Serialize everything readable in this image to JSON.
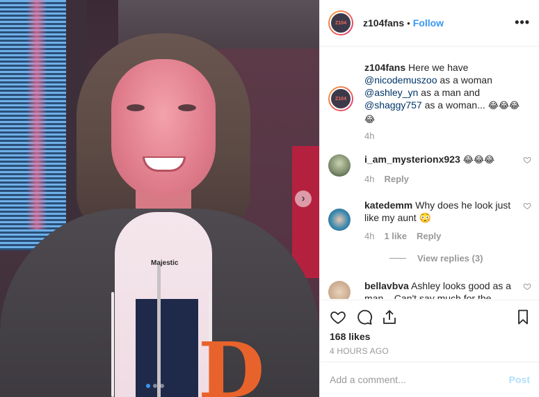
{
  "post": {
    "username": "z104fans",
    "follow_label": "Follow",
    "separator": "•",
    "more_label": "•••",
    "avatar_text": "Z104"
  },
  "photo": {
    "brand_mark": "Majestic",
    "team_logo": "D",
    "next_arrow": "›",
    "carousel_count": 3,
    "carousel_active": 0
  },
  "caption": {
    "username": "z104fans",
    "text_1": "Here we have",
    "mention_1": "@nicodemuszoo",
    "text_2": "as a woman",
    "mention_2": "@ashley_yn",
    "text_3": "as a man and",
    "mention_3": "@shaggy757",
    "text_4": "as a woman...",
    "emojis": "😂😂😂 😂",
    "time": "4h"
  },
  "comments": [
    {
      "username": "i_am_mysterionx923",
      "text": "😂😂😂",
      "time": "4h",
      "likes": "",
      "reply_label": "Reply",
      "avatar_color": "#7b8a6a"
    },
    {
      "username": "katedemm",
      "text": "Why does he look just like my aunt 😳",
      "time": "4h",
      "likes": "1 like",
      "reply_label": "Reply",
      "avatar_color": "#3e8ab0",
      "view_replies": "View replies (3)"
    },
    {
      "username": "bellavbva",
      "text": "Ashley looks good as a man... Can't say much for the",
      "time": "",
      "avatar_color": "#c9a98a"
    }
  ],
  "actions": {
    "likes": "168 likes",
    "time_ago": "4 HOURS AGO",
    "comment_placeholder": "Add a comment...",
    "post_label": "Post"
  },
  "colors": {
    "link_blue": "#3897f0",
    "mention_navy": "#003569",
    "muted": "#999999",
    "text": "#262626",
    "post_disabled": "#b2dffc"
  }
}
